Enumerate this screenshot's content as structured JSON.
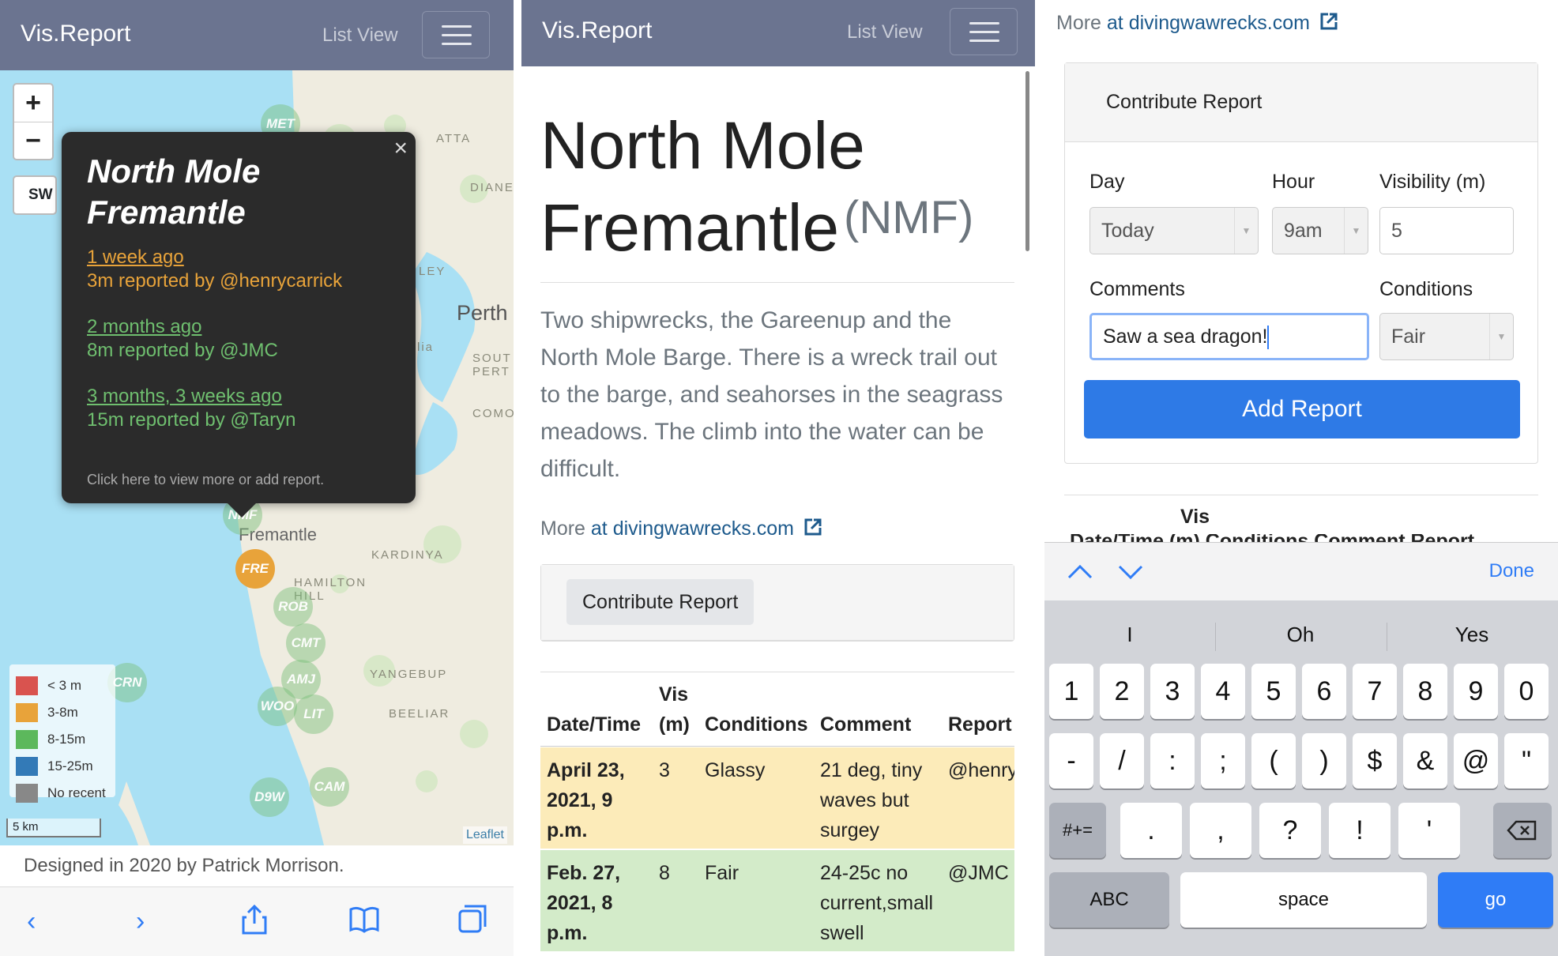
{
  "navbar": {
    "brand": "Vis.Report",
    "list_view": "List View"
  },
  "map": {
    "zoom_in": "+",
    "zoom_out": "−",
    "sw_button": "SW",
    "sites": [
      {
        "code": "MET"
      },
      {
        "code": "NMF"
      },
      {
        "code": "FRE"
      },
      {
        "code": "ROB"
      },
      {
        "code": "CMT"
      },
      {
        "code": "AMJ"
      },
      {
        "code": "CRN"
      },
      {
        "code": "WOO"
      },
      {
        "code": "LIT"
      },
      {
        "code": "D9W"
      },
      {
        "code": "CAM"
      }
    ],
    "places": {
      "perth": "Perth",
      "fremantle": "Fremantle",
      "kardinya": "KARDINYA",
      "hamilton_hill": "HAMILTON HILL",
      "yangebup": "YANGEBUP",
      "beeliar": "BEELIAR",
      "dianella": "DIANE",
      "south_perth": "SOUT PERT",
      "como": "COMO",
      "atta": "ATTA",
      "ley": "LEY",
      "lia": "lia"
    },
    "popup": {
      "close": "×",
      "title": "North Mole Fremantle",
      "entries": [
        {
          "when": "1 week ago",
          "detail": "3m reported by @henrycarrick",
          "color": "#e8a33a"
        },
        {
          "when": "2 months ago",
          "detail": "8m reported by @JMC",
          "color": "#6fbf6f"
        },
        {
          "when": "3 months, 3 weeks ago",
          "detail": "15m reported by @Taryn",
          "color": "#6fbf6f"
        }
      ],
      "footer": "Click here to view more or add report."
    },
    "legend": [
      {
        "label": "< 3 m",
        "color": "#d9534f"
      },
      {
        "label": "3-8m",
        "color": "#e8a33a"
      },
      {
        "label": "8-15m",
        "color": "#5cb85c"
      },
      {
        "label": "15-25m",
        "color": "#337ab7"
      },
      {
        "label": "No recent",
        "color": "#888888"
      }
    ],
    "scale": "5 km",
    "attribution": "Leaflet"
  },
  "footer_text": "Designed in 2020 by Patrick Morrison.",
  "site_page": {
    "title": "North Mole Fremantle",
    "code": "(NMF)",
    "description": "Two shipwrecks, the Gareenup and the North Mole Barge. There is a wreck trail out to the barge, and seahorses in the seagrass meadows. The climb into the water can be difficult.",
    "more_prefix": "More ",
    "more_at": "at ",
    "more_link": "divingwawrecks.com",
    "contribute": "Contribute Report",
    "table": {
      "headers": {
        "date": "Date/Time",
        "vis1": "Vis",
        "vis2": "(m)",
        "conditions": "Conditions",
        "comment": "Comment",
        "reporter": "Report"
      },
      "rows": [
        {
          "date": [
            "April 23,",
            "2021, 9",
            "p.m."
          ],
          "vis": "3",
          "conditions": "Glassy",
          "comment": [
            "21 deg, tiny",
            "waves but",
            "surgey"
          ],
          "reporter": "@henry",
          "color": "#fcebb9"
        },
        {
          "date": [
            "Feb. 27,",
            "2021, 8",
            "p.m."
          ],
          "vis": "8",
          "conditions": "Fair",
          "comment": [
            "24-25c no",
            "current,small",
            "swell"
          ],
          "reporter": "@JMC",
          "color": "#d3ebc9"
        }
      ]
    }
  },
  "form": {
    "more_prefix": "More ",
    "more_at": "at ",
    "more_link": "divingwawrecks.com",
    "header": "Contribute Report",
    "day_label": "Day",
    "day_value": "Today",
    "hour_label": "Hour",
    "hour_value": "9am",
    "vis_label": "Visibility (m)",
    "vis_value": "5",
    "comments_label": "Comments",
    "comments_value": "Saw a sea dragon!",
    "conditions_label": "Conditions",
    "conditions_value": "Fair",
    "add_button": "Add Report",
    "behind_vis": "Vis",
    "behind_partial": "Date/Time (m) Conditions Comment Report"
  },
  "keyboard": {
    "done": "Done",
    "suggestions": [
      "I",
      "Oh",
      "Yes"
    ],
    "row1": [
      "1",
      "2",
      "3",
      "4",
      "5",
      "6",
      "7",
      "8",
      "9",
      "0"
    ],
    "row2": [
      "-",
      "/",
      ":",
      ";",
      "(",
      ")",
      "$",
      "&",
      "@",
      "\""
    ],
    "row3": [
      ".",
      ",",
      "?",
      "!",
      "'"
    ],
    "symbols": "#+=",
    "abc": "ABC",
    "space": "space",
    "go": "go"
  }
}
